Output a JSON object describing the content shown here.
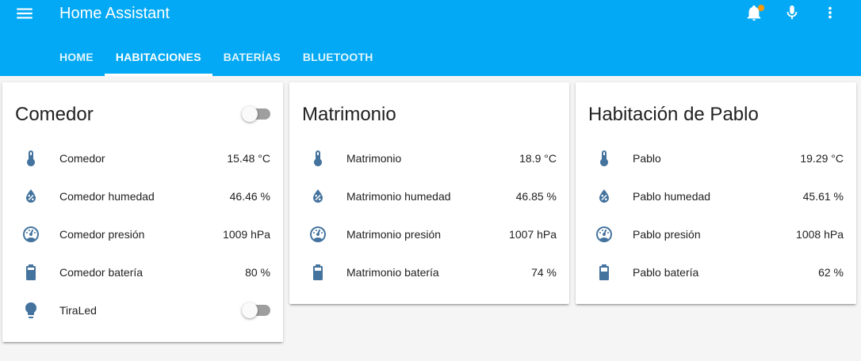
{
  "header": {
    "title": "Home Assistant",
    "icons": [
      "menu-icon",
      "bell-icon",
      "microphone-icon",
      "more-vertical-icon"
    ],
    "notification_indicator": true
  },
  "tabs": [
    {
      "label": "HOME",
      "active": false
    },
    {
      "label": "HABITACIONES",
      "active": true
    },
    {
      "label": "BATERÍAS",
      "active": false
    },
    {
      "label": "BLUETOOTH",
      "active": false
    }
  ],
  "cards": [
    {
      "title": "Comedor",
      "header_toggle": "off",
      "rows": [
        {
          "icon": "thermometer-icon",
          "name": "Comedor",
          "value": "15.48 °C"
        },
        {
          "icon": "water-percent-icon",
          "name": "Comedor humedad",
          "value": "46.46 %"
        },
        {
          "icon": "gauge-icon",
          "name": "Comedor presión",
          "value": "1009 hPa"
        },
        {
          "icon": "battery-icon",
          "name": "Comedor batería",
          "value": "80 %"
        },
        {
          "icon": "lightbulb-icon",
          "name": "TiraLed",
          "toggle": "off"
        }
      ]
    },
    {
      "title": "Matrimonio",
      "rows": [
        {
          "icon": "thermometer-icon",
          "name": "Matrimonio",
          "value": "18.9 °C"
        },
        {
          "icon": "water-percent-icon",
          "name": "Matrimonio humedad",
          "value": "46.85 %"
        },
        {
          "icon": "gauge-icon",
          "name": "Matrimonio presión",
          "value": "1007 hPa"
        },
        {
          "icon": "battery-icon",
          "name": "Matrimonio batería",
          "value": "74 %"
        }
      ]
    },
    {
      "title": "Habitación de Pablo",
      "rows": [
        {
          "icon": "thermometer-icon",
          "name": "Pablo",
          "value": "19.29 °C"
        },
        {
          "icon": "water-percent-icon",
          "name": "Pablo humedad",
          "value": "45.61 %"
        },
        {
          "icon": "gauge-icon",
          "name": "Pablo presión",
          "value": "1008 hPa"
        },
        {
          "icon": "battery-icon",
          "name": "Pablo batería",
          "value": "62 %"
        }
      ]
    }
  ],
  "colors": {
    "primary": "#03a9f4",
    "icon": "#44739e",
    "notification": "#ff9800",
    "toggle_off": "#9e9e9e"
  }
}
